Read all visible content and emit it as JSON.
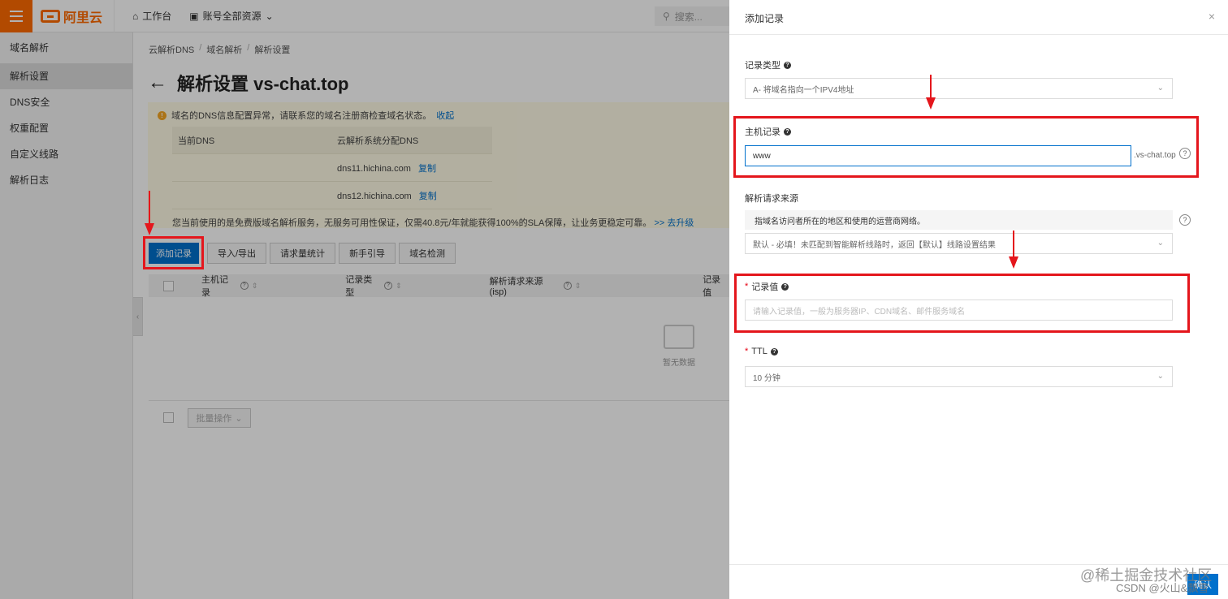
{
  "topbar": {
    "brand": "阿里云",
    "workbench": "工作台",
    "account_scope": "账号全部资源",
    "search_placeholder": "搜索..."
  },
  "sidebar": {
    "title": "域名解析",
    "items": [
      "解析设置",
      "DNS安全",
      "权重配置",
      "自定义线路",
      "解析日志"
    ],
    "active_index": 0
  },
  "breadcrumb": [
    "云解析DNS",
    "域名解析",
    "解析设置"
  ],
  "page_title": "解析设置 vs-chat.top",
  "notice": {
    "message": "域名的DNS信息配置异常，请联系您的域名注册商检查域名状态。",
    "collapse": "收起",
    "col_current": "当前DNS",
    "col_assigned": "云解析系统分配DNS",
    "rows": [
      {
        "current": "",
        "assigned": "dns11.hichina.com",
        "copy": "复制"
      },
      {
        "current": "",
        "assigned": "dns12.hichina.com",
        "copy": "复制"
      }
    ],
    "footer": "您当前使用的是免费版域名解析服务，无服务可用性保证，仅需40.8元/年就能获得100%的SLA保障，让业务更稳定可靠。",
    "upgrade": ">> 去升级"
  },
  "toolbar": {
    "add_record": "添加记录",
    "import_export": "导入/导出",
    "request_stats": "请求量统计",
    "guide": "新手引导",
    "domain_check": "域名检测"
  },
  "table": {
    "columns": [
      "主机记录",
      "记录类型",
      "解析请求来源(isp)",
      "记录值"
    ],
    "empty_text": "暂无数据",
    "bulk_action": "批量操作"
  },
  "drawer": {
    "title": "添加记录",
    "close": "×",
    "record_type": {
      "label": "记录类型",
      "value": "A- 将域名指向一个IPV4地址"
    },
    "host_record": {
      "label": "主机记录",
      "value": "www",
      "suffix": ".vs-chat.top"
    },
    "request_source": {
      "label": "解析请求来源",
      "hint": "指域名访问者所在的地区和使用的运营商网络。",
      "value": "默认 - 必填！未匹配到智能解析线路时，返回【默认】线路设置结果"
    },
    "record_value": {
      "label": "记录值",
      "placeholder": "请输入记录值，一般为服务器IP、CDN域名、邮件服务域名"
    },
    "ttl": {
      "label": "TTL",
      "value": "10 分钟"
    },
    "confirm": "确认"
  },
  "watermarks": {
    "juejin": "@稀土掘金技术社区",
    "csdn": "CSDN @火山&飘雪"
  },
  "colors": {
    "brand": "#ff6a00",
    "primary": "#0070cc",
    "annotation_red": "#e4161c"
  }
}
